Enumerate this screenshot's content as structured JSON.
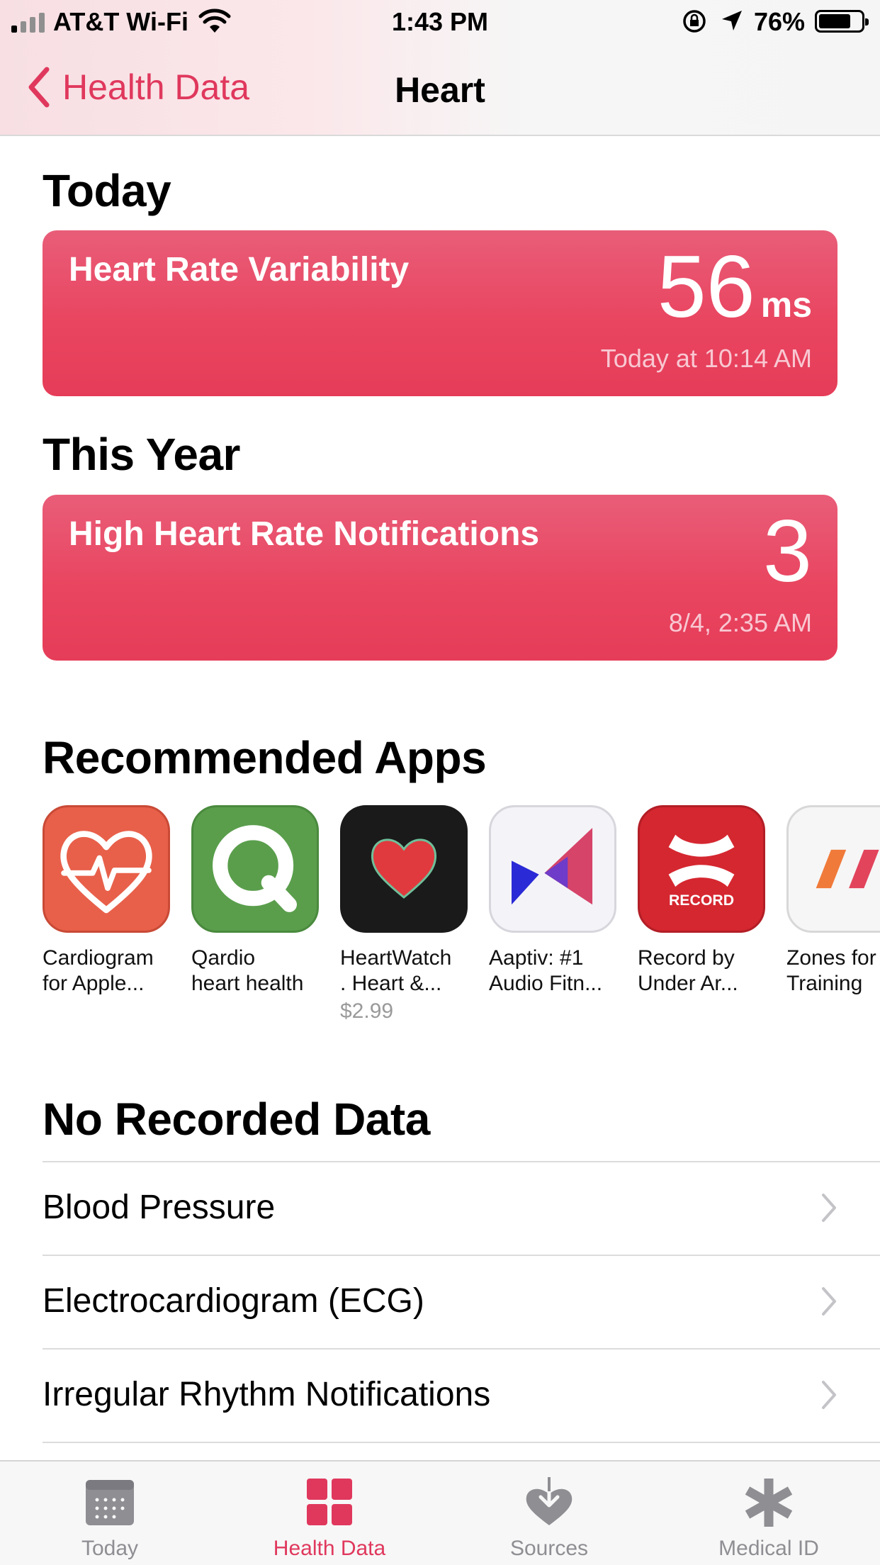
{
  "status_bar": {
    "carrier": "AT&T Wi-Fi",
    "time": "1:43 PM",
    "battery": "76%",
    "battery_level": 0.76
  },
  "nav": {
    "back_label": "Health Data",
    "title": "Heart"
  },
  "sections": {
    "today_title": "Today",
    "year_title": "This Year",
    "apps_title": "Recommended Apps",
    "no_data_title": "No Recorded Data"
  },
  "cards": {
    "hrv": {
      "label": "Heart Rate Variability",
      "value": "56",
      "unit": "ms",
      "date": "Today at 10:14 AM"
    },
    "high_hr": {
      "label": "High Heart Rate Notifications",
      "value": "3",
      "date": "8/4, 2:35 AM"
    }
  },
  "apps": [
    {
      "name": "Cardiogram\nfor Apple...",
      "icon": "cardiogram-heart-icon",
      "color": "#e8604a"
    },
    {
      "name": "Qardio\nheart health",
      "icon": "qardio-q-icon",
      "color": "#5a9e4c"
    },
    {
      "name": "HeartWatch\n. Heart &...",
      "icon": "heartwatch-heart-icon",
      "color": "#1a1a1a",
      "price": "$2.99"
    },
    {
      "name": "Aaptiv: #1\nAudio Fitn...",
      "icon": "aaptiv-icon",
      "color": "#f4f4f8"
    },
    {
      "name": "Record by\nUnder Ar...",
      "icon": "under-armour-icon",
      "color": "#d52730",
      "icon_text": "RECORD"
    },
    {
      "name": "Zones for\nTraining",
      "icon": "zones-stripes-icon",
      "color": "#f6f6f6"
    }
  ],
  "no_data_items": [
    {
      "label": "Blood Pressure"
    },
    {
      "label": "Electrocardiogram (ECG)"
    },
    {
      "label": "Irregular Rhythm Notifications"
    }
  ],
  "tabs": [
    {
      "label": "Today",
      "icon": "calendar-icon",
      "active": false
    },
    {
      "label": "Health Data",
      "icon": "grid-icon",
      "active": true
    },
    {
      "label": "Sources",
      "icon": "heart-download-icon",
      "active": false
    },
    {
      "label": "Medical ID",
      "icon": "asterisk-icon",
      "active": false
    }
  ],
  "colors": {
    "accent": "#e0385d",
    "card": "#e94560",
    "inactive_tab": "#8e8e93"
  }
}
